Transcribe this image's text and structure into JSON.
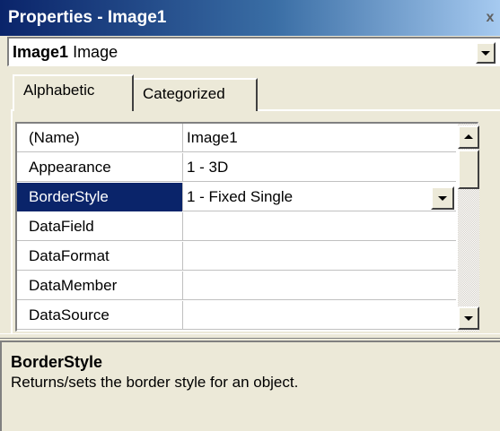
{
  "window": {
    "title": "Properties - Image1",
    "close_glyph": "x"
  },
  "object_selector": {
    "name": "Image1",
    "type": "Image"
  },
  "tabs": [
    {
      "label": "Alphabetic",
      "active": true
    },
    {
      "label": "Categorized",
      "active": false
    }
  ],
  "properties": [
    {
      "name": "(Name)",
      "value": "Image1"
    },
    {
      "name": "Appearance",
      "value": "1 - 3D"
    },
    {
      "name": "BorderStyle",
      "value": "1 - Fixed Single",
      "selected": true
    },
    {
      "name": "DataField",
      "value": ""
    },
    {
      "name": "DataFormat",
      "value": ""
    },
    {
      "name": "DataMember",
      "value": ""
    },
    {
      "name": "DataSource",
      "value": ""
    }
  ],
  "description": {
    "title": "BorderStyle",
    "text": "Returns/sets the border style for an object."
  },
  "colors": {
    "titlebar_start": "#0a246a",
    "titlebar_end": "#a6caf0",
    "selection": "#0a246a",
    "face": "#ece9d8"
  }
}
